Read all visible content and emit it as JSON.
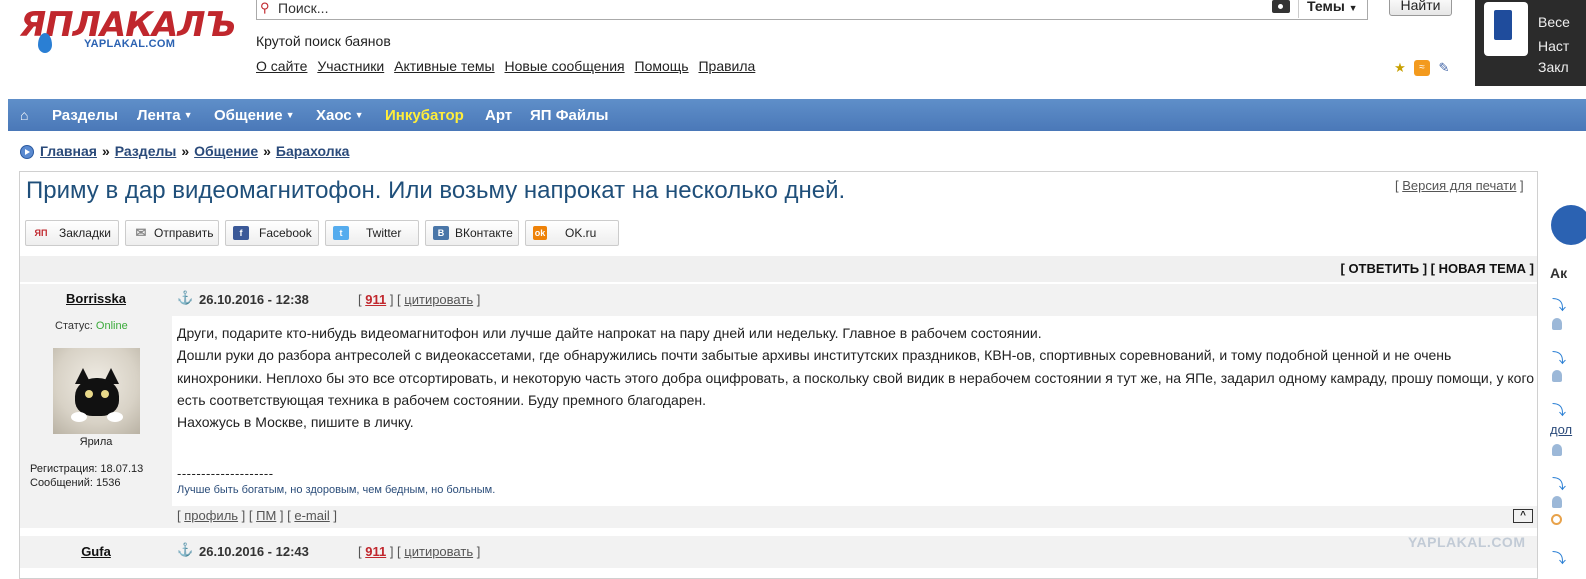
{
  "header": {
    "logo_main": "ЯПЛАКАЛЪ",
    "logo_sub": "YAPLAKAL.COM",
    "search_placeholder": "Поиск...",
    "search_scope": "Темы",
    "search_button": "Найти",
    "tagline": "Крутой поиск баянов",
    "links": [
      "О сайте",
      "Участники",
      "Активные темы",
      "Новые сообщения",
      "Помощь",
      "Правила"
    ]
  },
  "side_panel": {
    "line1": "Весе",
    "line2": "Наст",
    "line3": "Закл"
  },
  "nav": {
    "items": [
      {
        "label": "Разделы",
        "dropdown": false
      },
      {
        "label": "Лента",
        "dropdown": true
      },
      {
        "label": "Общение",
        "dropdown": true
      },
      {
        "label": "Хаос",
        "dropdown": true
      },
      {
        "label": "Инкубатор",
        "dropdown": false,
        "highlight": "#ffee3a"
      },
      {
        "label": "Арт",
        "dropdown": false
      },
      {
        "label": "ЯП Файлы",
        "dropdown": false
      }
    ]
  },
  "breadcrumb": [
    "Главная",
    "Разделы",
    "Общение",
    "Барахолка"
  ],
  "topic": {
    "title": "Приму в дар видеомагнитофон. Или возьму напрокат на несколько дней.",
    "print_link": "Версия для печати",
    "share": [
      {
        "label": "Закладки",
        "icon": "ЯП",
        "color": "#c0272d"
      },
      {
        "label": "Отправить",
        "icon": "✉",
        "color": "#8a8a8a"
      },
      {
        "label": "Facebook",
        "icon": "f",
        "color": "#3b5998"
      },
      {
        "label": "Twitter",
        "icon": "t",
        "color": "#55acee"
      },
      {
        "label": "ВКонтакте",
        "icon": "B",
        "color": "#4a76a8"
      },
      {
        "label": "OK.ru",
        "icon": "ok",
        "color": "#ee8208"
      }
    ],
    "reply_label": "ОТВЕТИТЬ",
    "new_topic_label": "НОВАЯ ТЕМА"
  },
  "posts": [
    {
      "author": "Borrisska",
      "date": "26.10.2016 - 12:38",
      "rating": "911",
      "quote_label": "цитировать",
      "status_label": "Статус:",
      "status": "Online",
      "rank": "Ярила",
      "reg_label": "Регистрация:",
      "reg_date": "18.07.13",
      "posts_label": "Сообщений:",
      "posts_count": "1536",
      "body": [
        "Други, подарите кто-нибудь видеомагнитофон или лучше дайте напрокат на пару дней или недельку. Главное в рабочем состоянии.",
        "Дошли руки до разбора антресолей с видеокассетами, где обнаружились почти забытые архивы институтских праздников, КВН-ов, спортивных соревнований, и тому подобной ценной и не очень кинохроники. Неплохо бы это все отсортировать, и некоторую часть этого добра оцифровать, а поскольку свой видик в нерабочем состоянии я тут же, на ЯПе, задарил одному камраду, прошу помощи, у кого есть соответствующая техника в рабочем состоянии. Буду премного благодарен.",
        "Нахожусь в Москве, пишите в личку."
      ],
      "sig_line": "--------------------",
      "signature": "Лучше быть богатым, но здоровым, чем бедным, но больным.",
      "footer": [
        "профиль",
        "ПМ",
        "e-mail"
      ],
      "top_btn": "^"
    },
    {
      "author": "Gufa",
      "date": "26.10.2016 - 12:43",
      "rating": "911",
      "quote_label": "цитировать"
    }
  ],
  "right_edge": {
    "label": "Ак",
    "link": "дол"
  },
  "watermark": "YAPLAKAL.COM"
}
